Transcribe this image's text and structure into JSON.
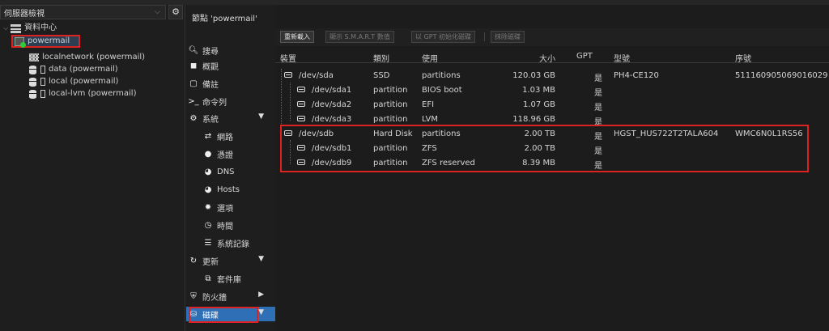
{
  "left_panel": {
    "view_selector": "伺服器檢視",
    "tree": {
      "datacenter": "資料中心",
      "node": "powermail",
      "items": [
        "localnetwork (powermail)",
        "data (powermail)",
        "local (powermail)",
        "local-lvm (powermail)"
      ]
    }
  },
  "nav": {
    "title": "節點 'powermail'",
    "items": {
      "search": "搜尋",
      "summary": "概觀",
      "notes": "備註",
      "shell": "命令列",
      "system": "系統",
      "network": "網路",
      "certificates": "憑證",
      "dns": "DNS",
      "hosts": "Hosts",
      "options": "選項",
      "time": "時間",
      "syslog": "系統記錄",
      "updates": "更新",
      "repositories": "套件庫",
      "firewall": "防火牆",
      "disks": "磁碟"
    }
  },
  "toolbar": {
    "reload": "重新載入",
    "show_smart": "顯示 S.M.A.R.T 數值",
    "init_gpt": "以 GPT 初始化磁碟",
    "wipe": "抹除磁碟"
  },
  "table": {
    "headers": {
      "device": "裝置",
      "type": "類別",
      "usage": "使用",
      "size": "大小",
      "gpt": "GPT",
      "model": "型號",
      "serial": "序號"
    },
    "rows": [
      {
        "device": "/dev/sda",
        "type": "SSD",
        "usage": "partitions",
        "size": "120.03 GB",
        "gpt": "是",
        "model": "PH4-CE120",
        "serial": "511160905069016029"
      },
      {
        "device": "/dev/sda1",
        "type": "partition",
        "usage": "BIOS boot",
        "size": "1.03 MB",
        "gpt": "是",
        "model": "",
        "serial": ""
      },
      {
        "device": "/dev/sda2",
        "type": "partition",
        "usage": "EFI",
        "size": "1.07 GB",
        "gpt": "是",
        "model": "",
        "serial": ""
      },
      {
        "device": "/dev/sda3",
        "type": "partition",
        "usage": "LVM",
        "size": "118.96 GB",
        "gpt": "是",
        "model": "",
        "serial": ""
      },
      {
        "device": "/dev/sdb",
        "type": "Hard Disk",
        "usage": "partitions",
        "size": "2.00 TB",
        "gpt": "是",
        "model": "HGST_HUS722T2TALA604",
        "serial": "WMC6N0L1RS56"
      },
      {
        "device": "/dev/sdb1",
        "type": "partition",
        "usage": "ZFS",
        "size": "2.00 TB",
        "gpt": "是",
        "model": "",
        "serial": ""
      },
      {
        "device": "/dev/sdb9",
        "type": "partition",
        "usage": "ZFS reserved",
        "size": "8.39 MB",
        "gpt": "是",
        "model": "",
        "serial": ""
      }
    ]
  },
  "colors": {
    "accent": "#2f6fb6",
    "highlight": "#dd2222",
    "background": "#1c1c1c"
  }
}
